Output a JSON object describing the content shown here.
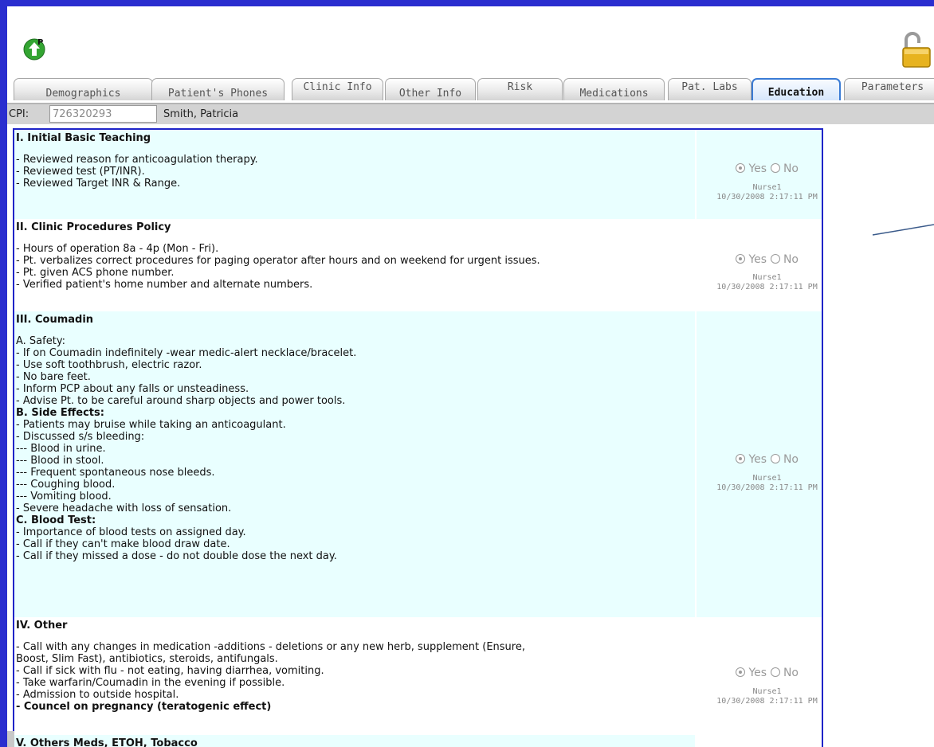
{
  "tabs": [
    {
      "label": "Demographics",
      "active": false
    },
    {
      "label": "Patient's Phones",
      "active": false
    },
    {
      "label": "Clinic Info",
      "active": false
    },
    {
      "label": "Other Info",
      "active": false
    },
    {
      "label": "Risk",
      "active": false
    },
    {
      "label": "Medications",
      "active": false
    },
    {
      "label": "Pat. Labs",
      "active": false
    },
    {
      "label": "Education",
      "active": true
    },
    {
      "label": "Parameters",
      "active": false
    }
  ],
  "patient": {
    "cpi_label": "CPI:",
    "cpi_value": "726320293",
    "name": "Smith, Patricia"
  },
  "icons": {
    "app": "green-up-arrow-p-icon",
    "lock": "padlock-unlocked-icon"
  },
  "radio": {
    "yes_label": "Yes",
    "no_label": "No"
  },
  "sections": [
    {
      "title": "I. Initial Basic Teaching",
      "lines": [
        {
          "text": "- Reviewed reason for anticoagulation therapy.",
          "bold": false
        },
        {
          "text": "- Reviewed test (PT/INR).",
          "bold": false
        },
        {
          "text": "- Reviewed Target INR & Range.",
          "bold": false
        }
      ],
      "selected": "Yes",
      "nurse": "Nurse1",
      "timestamp": "10/30/2008 2:17:11 PM"
    },
    {
      "title": "II. Clinic Procedures Policy",
      "lines": [
        {
          "text": "- Hours of operation 8a - 4p (Mon - Fri).",
          "bold": false
        },
        {
          "text": "- Pt. verbalizes correct procedures for paging operator after hours and on weekend for urgent issues.",
          "bold": false
        },
        {
          "text": "- Pt. given ACS phone number.",
          "bold": false
        },
        {
          "text": "- Verified patient's home number and alternate numbers.",
          "bold": false
        }
      ],
      "selected": "Yes",
      "nurse": "Nurse1",
      "timestamp": "10/30/2008 2:17:11 PM"
    },
    {
      "title": "III. Coumadin",
      "lines": [
        {
          "text": "A. Safety:",
          "bold": false
        },
        {
          "text": "- If on Coumadin indefinitely -wear medic-alert necklace/bracelet.",
          "bold": false
        },
        {
          "text": "- Use soft toothbrush, electric razor.",
          "bold": false
        },
        {
          "text": "- No bare feet.",
          "bold": false
        },
        {
          "text": "- Inform PCP about any falls or unsteadiness.",
          "bold": false
        },
        {
          "text": "- Advise Pt. to be careful around sharp objects and power tools.",
          "bold": false
        },
        {
          "text": "B. Side Effects:",
          "bold": true
        },
        {
          "text": "- Patients may bruise while taking an anticoagulant.",
          "bold": false
        },
        {
          "text": "- Discussed s/s bleeding:",
          "bold": false
        },
        {
          "text": "--- Blood in urine.",
          "bold": false
        },
        {
          "text": "--- Blood in stool.",
          "bold": false
        },
        {
          "text": "--- Frequent spontaneous nose bleeds.",
          "bold": false
        },
        {
          "text": "--- Coughing blood.",
          "bold": false
        },
        {
          "text": "--- Vomiting blood.",
          "bold": false
        },
        {
          "text": "- Severe headache with loss of sensation.",
          "bold": false
        },
        {
          "text": "C. Blood Test:",
          "bold": true
        },
        {
          "text": "- Importance of blood tests on assigned day.",
          "bold": false
        },
        {
          "text": "- Call if they can't make blood draw date.",
          "bold": false
        },
        {
          "text": "- Call if they missed a dose - do not double dose the next day.",
          "bold": false
        }
      ],
      "selected": "Yes",
      "nurse": "Nurse1",
      "timestamp": "10/30/2008 2:17:11 PM"
    },
    {
      "title": "IV. Other",
      "lines": [
        {
          "text": "- Call with any changes in medication -additions - deletions or any new herb, supplement (Ensure,",
          "bold": false
        },
        {
          "text": "Boost, Slim Fast), antibiotics, steroids, antifungals.",
          "bold": false
        },
        {
          "text": "- Call if sick with flu - not eating, having diarrhea, vomiting.",
          "bold": false
        },
        {
          "text": "- Take warfarin/Coumadin in the evening if possible.",
          "bold": false
        },
        {
          "text": "- Admission to outside hospital.",
          "bold": false
        },
        {
          "text": "- Councel on pregnancy (teratogenic effect)",
          "bold": true
        }
      ],
      "selected": "Yes",
      "nurse": "Nurse1",
      "timestamp": "10/30/2008 2:17:11 PM"
    },
    {
      "title": "V. Others Meds, ETOH, Tobacco",
      "lines": [],
      "selected": "",
      "nurse": "",
      "timestamp": ""
    }
  ]
}
